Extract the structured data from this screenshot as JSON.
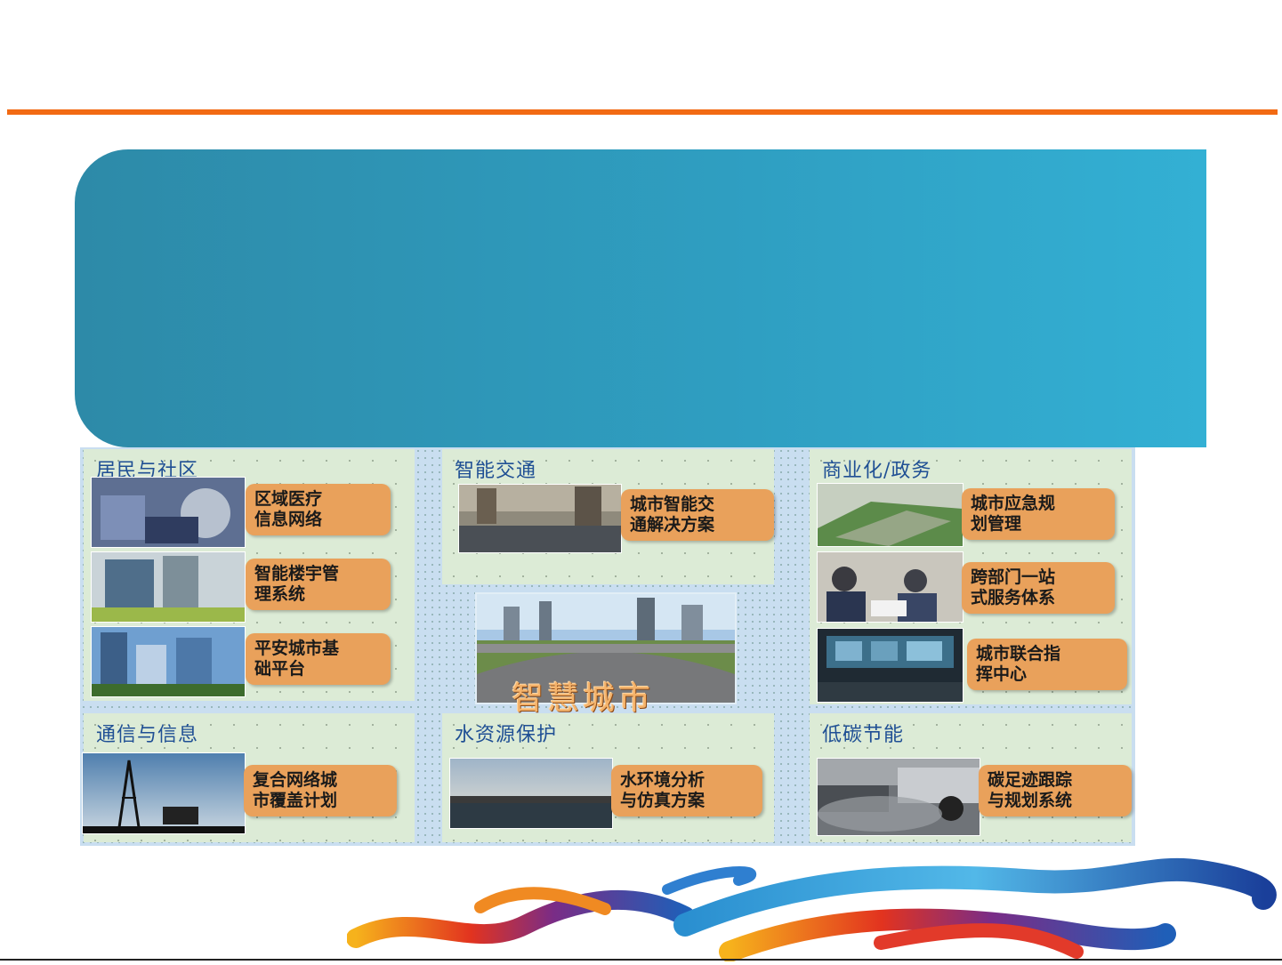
{
  "colors": {
    "accent_rule": "#f26a13",
    "banner": "#2f9fc2",
    "panel_title": "#1f4f94",
    "tag": "#e9a15b"
  },
  "panels": {
    "residents": {
      "title": "居民与社区"
    },
    "traffic": {
      "title": "智能交通"
    },
    "business": {
      "title": "商业化/政务"
    },
    "telecom": {
      "title": "通信与信息"
    },
    "water": {
      "title": "水资源保护"
    },
    "lowcarbon": {
      "title": "低碳节能"
    }
  },
  "items": {
    "medical": [
      "区域医疗",
      "信息网络"
    ],
    "building": [
      "智能楼宇管",
      "理系统"
    ],
    "safecity": [
      "平安城市基",
      "础平台"
    ],
    "traffic_solution": [
      "城市智能交",
      "通解决方案"
    ],
    "emergency": [
      "城市应急规",
      "划管理"
    ],
    "onestop": [
      "跨部门一站",
      "式服务体系"
    ],
    "command": [
      "城市联合指",
      "挥中心"
    ],
    "network": [
      "复合网络城",
      "市覆盖计划"
    ],
    "waterenv": [
      "水环境分析",
      "与仿真方案"
    ],
    "carbon": [
      "碳足迹跟踪",
      "与规划系统"
    ]
  },
  "center": {
    "caption": "智慧城市"
  },
  "icons": [
    "swirl-decoration"
  ]
}
